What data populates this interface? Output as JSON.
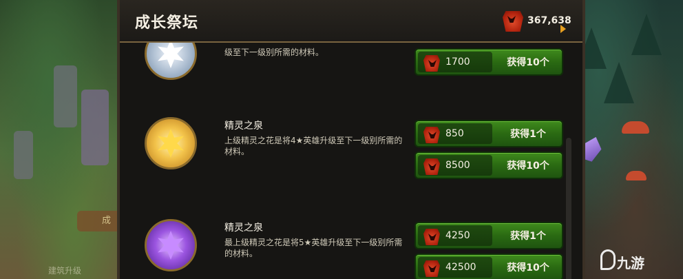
{
  "header": {
    "title": "成长祭坛",
    "currency_value": "367,638",
    "currency_icon": "red-gem-icon"
  },
  "items": [
    {
      "name": "",
      "description": "级至下一级别所需的材料。",
      "icon": "silver-flower-icon",
      "buttons": [
        {
          "cost": "1700",
          "action": "获得10个"
        }
      ]
    },
    {
      "name": "精灵之泉",
      "description": "上级精灵之花是将4★英雄升级至下一级别所需的材料。",
      "icon": "gold-flower-icon",
      "buttons": [
        {
          "cost": "850",
          "action": "获得1个"
        },
        {
          "cost": "8500",
          "action": "获得10个"
        }
      ]
    },
    {
      "name": "精灵之泉",
      "description": "最上级精灵之花是将5★英雄升级至下一级别所需的材料。",
      "icon": "purple-flower-icon",
      "buttons": [
        {
          "cost": "4250",
          "action": "获得1个"
        },
        {
          "cost": "42500",
          "action": "获得10个"
        }
      ]
    }
  ],
  "background": {
    "left_button_label": "成",
    "left_bottom_label": "建筑升级"
  },
  "watermark": "九游",
  "colors": {
    "button_green": "#2a6a12",
    "gem_red": "#b3240f",
    "panel_bg": "#161513"
  }
}
